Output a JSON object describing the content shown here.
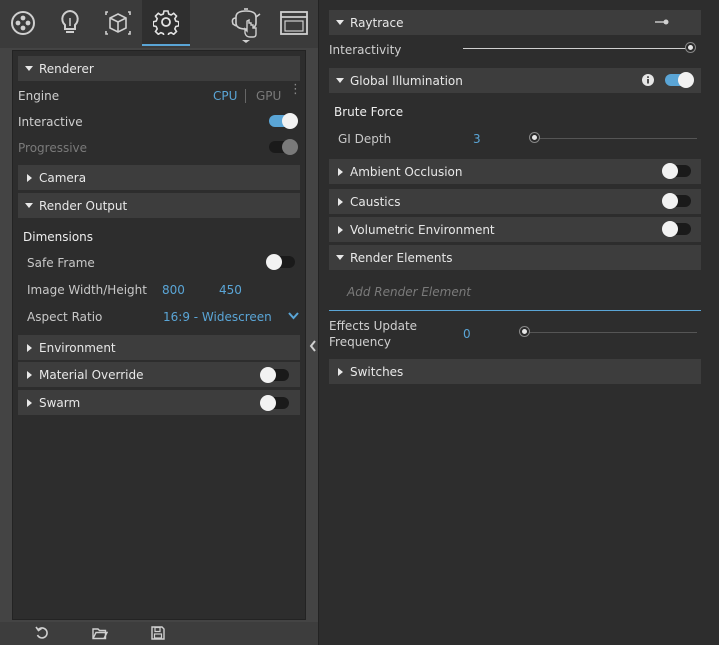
{
  "left": {
    "renderer": {
      "title": "Renderer",
      "engine_label": "Engine",
      "engine_options": [
        "CPU",
        "GPU"
      ],
      "engine_selected": "CPU",
      "interactive_label": "Interactive",
      "interactive_on": true,
      "progressive_label": "Progressive",
      "progressive_on": true
    },
    "camera": {
      "title": "Camera"
    },
    "render_output": {
      "title": "Render Output",
      "dimensions_label": "Dimensions",
      "safe_frame_label": "Safe Frame",
      "safe_frame_on": false,
      "image_wh_label": "Image Width/Height",
      "width": "800",
      "height": "450",
      "aspect_label": "Aspect Ratio",
      "aspect_value": "16:9 - Widescreen"
    },
    "environment": {
      "title": "Environment"
    },
    "material_override": {
      "title": "Material Override",
      "on": false
    },
    "swarm": {
      "title": "Swarm",
      "on": false
    }
  },
  "tabs": [
    "geometry-icon",
    "lightbulb-icon",
    "cube-icon",
    "gear-icon",
    "teapot-render-icon",
    "frame-buffer-icon"
  ],
  "bottom_buttons": [
    "reset-icon",
    "open-folder-icon",
    "save-icon"
  ],
  "right": {
    "raytrace": {
      "title": "Raytrace"
    },
    "interactivity": {
      "label": "Interactivity",
      "level": 1.0
    },
    "global_illumination": {
      "title": "Global Illumination",
      "on": true
    },
    "brute_force": {
      "label": "Brute Force"
    },
    "gi_depth": {
      "label": "GI Depth",
      "value": "3",
      "level": 0.0
    },
    "ambient_occlusion": {
      "title": "Ambient Occlusion",
      "on": false
    },
    "caustics": {
      "title": "Caustics",
      "on": false
    },
    "volumetric_environment": {
      "title": "Volumetric Environment",
      "on": false
    },
    "render_elements": {
      "title": "Render Elements",
      "placeholder": "Add Render Element"
    },
    "effects_update": {
      "label_line1": "Effects Update",
      "label_line2": "Frequency",
      "value": "0",
      "level": 0.0
    },
    "switches": {
      "title": "Switches"
    }
  },
  "colors": {
    "accent": "#5aa5d6",
    "panel": "#2d2d2d",
    "header": "#3d3d3d"
  }
}
